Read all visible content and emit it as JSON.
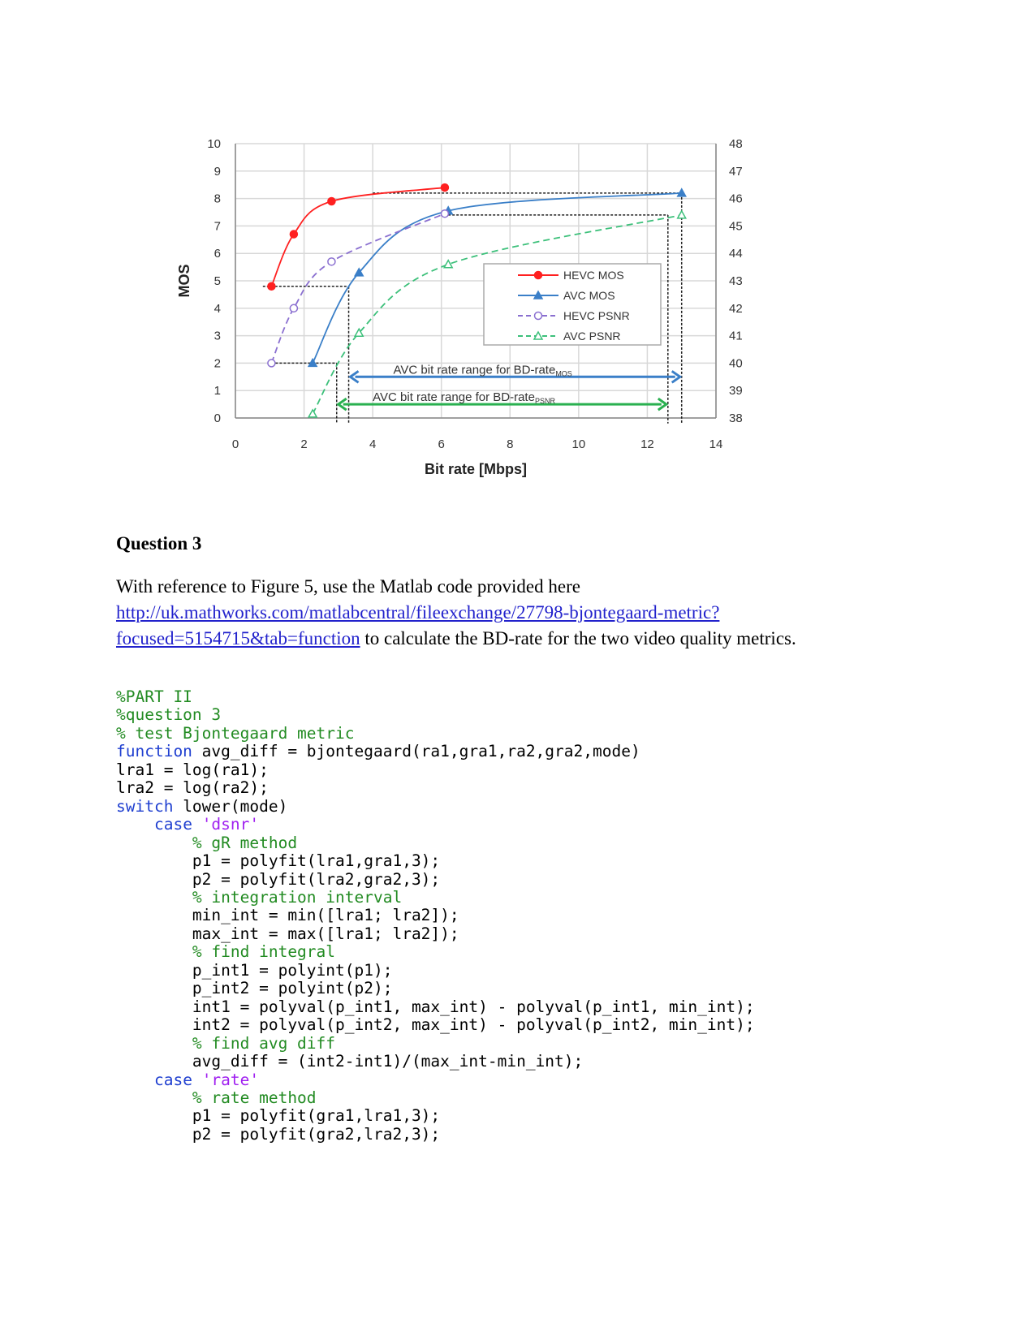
{
  "chart_data": {
    "type": "line",
    "xlabel": "Bit rate [Mbps]",
    "ylabel": "MOS",
    "xlim": [
      0,
      14
    ],
    "ylim": [
      0,
      10
    ],
    "y2lim": [
      38,
      48
    ],
    "xticks": [
      "0",
      "2",
      "4",
      "6",
      "8",
      "10",
      "12",
      "14"
    ],
    "yticks": [
      "0",
      "1",
      "2",
      "3",
      "4",
      "5",
      "6",
      "7",
      "8",
      "9",
      "10"
    ],
    "y2ticks": [
      "38",
      "39",
      "40",
      "41",
      "42",
      "43",
      "44",
      "45",
      "46",
      "47",
      "48"
    ],
    "grid": true,
    "legend_position": "center-right",
    "series": [
      {
        "name": "HEVC MOS",
        "color": "#ff2020",
        "style": "solid",
        "marker": "filled-circle",
        "x": [
          1.05,
          1.7,
          2.8,
          6.1
        ],
        "y": [
          4.8,
          6.7,
          7.9,
          8.4
        ]
      },
      {
        "name": "AVC MOS",
        "color": "#3a7fc8",
        "style": "solid",
        "marker": "filled-triangle",
        "x": [
          2.25,
          3.6,
          6.2,
          13.0
        ],
        "y": [
          2.0,
          5.3,
          7.55,
          8.2
        ]
      },
      {
        "name": "HEVC PSNR",
        "color": "#8a6fd0",
        "style": "dashed",
        "marker": "open-circle",
        "x": [
          1.05,
          1.7,
          2.8,
          6.1
        ],
        "y": [
          2.0,
          4.0,
          5.7,
          7.45
        ]
      },
      {
        "name": "AVC PSNR",
        "color": "#3cc07a",
        "style": "dashed",
        "marker": "open-triangle",
        "x": [
          2.25,
          3.6,
          6.2,
          13.0
        ],
        "y": [
          0.15,
          3.1,
          5.6,
          7.4
        ]
      }
    ],
    "reference_lines": [
      {
        "x": [
          0.8,
          3.3
        ],
        "y": [
          4.8,
          4.8
        ]
      },
      {
        "x": [
          3.3,
          3.3
        ],
        "y": [
          4.8,
          -0.2
        ]
      },
      {
        "x": [
          1.05,
          2.95
        ],
        "y": [
          2.0,
          2.0
        ]
      },
      {
        "x": [
          2.95,
          2.95
        ],
        "y": [
          2.0,
          -0.2
        ]
      },
      {
        "x": [
          4.0,
          13.0
        ],
        "y": [
          8.2,
          8.2
        ]
      },
      {
        "x": [
          13.0,
          13.0
        ],
        "y": [
          8.2,
          -0.2
        ]
      },
      {
        "x": [
          6.2,
          12.6
        ],
        "y": [
          7.4,
          7.4
        ]
      },
      {
        "x": [
          12.6,
          12.6
        ],
        "y": [
          7.4,
          -0.2
        ]
      }
    ],
    "annotations": [
      {
        "text": "AVC bit rate range for BD-rate",
        "sub": "MOS",
        "color": "#3a7fc8",
        "x_from": 3.3,
        "x_to": 13.0,
        "y": 1.5
      },
      {
        "text": "AVC bit rate range for BD-rate",
        "sub": "PSNR",
        "color": "#2ab050",
        "x_from": 2.95,
        "x_to": 12.6,
        "y": 0.5
      }
    ]
  },
  "heading": "Question 3",
  "paragraph": {
    "before": "With reference to Figure 5, use the Matlab code provided here",
    "link": "http://uk.mathworks.com/matlabcentral/fileexchange/27798-bjontegaard-metric?focused=5154715&tab=function",
    "link_line1": "http://uk.mathworks.com/matlabcentral/fileexchange/27798-bjontegaard-metric?",
    "link_line2": "focused=5154715&tab=function",
    "after": " to calculate the BD-rate for the two video quality metrics."
  },
  "code": [
    [
      [
        "cm",
        "%PART II"
      ]
    ],
    [
      [
        "cm",
        "%question 3"
      ]
    ],
    [
      [
        "cm",
        "% test Bjontegaard metric"
      ]
    ],
    [
      [
        "kw",
        "function"
      ],
      [
        "tx",
        " avg_diff = bjontegaard(ra1,gra1,ra2,gra2,mode)"
      ]
    ],
    [
      [
        "tx",
        "lra1 = log(ra1);"
      ]
    ],
    [
      [
        "tx",
        "lra2 = log(ra2);"
      ]
    ],
    [
      [
        "kw",
        "switch"
      ],
      [
        "tx",
        " lower(mode)"
      ]
    ],
    [
      [
        "tx",
        "    "
      ],
      [
        "kw",
        "case"
      ],
      [
        "tx",
        " "
      ],
      [
        "st",
        "'dsnr'"
      ]
    ],
    [
      [
        "tx",
        "        "
      ],
      [
        "cm",
        "% gR method"
      ]
    ],
    [
      [
        "tx",
        "        p1 = polyfit(lra1,gra1,3);"
      ]
    ],
    [
      [
        "tx",
        "        p2 = polyfit(lra2,gra2,3);"
      ]
    ],
    [
      [
        "tx",
        "        "
      ],
      [
        "cm",
        "% integration interval"
      ]
    ],
    [
      [
        "tx",
        "        min_int = min([lra1; lra2]);"
      ]
    ],
    [
      [
        "tx",
        "        max_int = max([lra1; lra2]);"
      ]
    ],
    [
      [
        "tx",
        "        "
      ],
      [
        "cm",
        "% find integral"
      ]
    ],
    [
      [
        "tx",
        "        p_int1 = polyint(p1);"
      ]
    ],
    [
      [
        "tx",
        "        p_int2 = polyint(p2);"
      ]
    ],
    [
      [
        "tx",
        "        int1 = polyval(p_int1, max_int) - polyval(p_int1, min_int);"
      ]
    ],
    [
      [
        "tx",
        "        int2 = polyval(p_int2, max_int) - polyval(p_int2, min_int);"
      ]
    ],
    [
      [
        "tx",
        "        "
      ],
      [
        "cm",
        "% find avg diff"
      ]
    ],
    [
      [
        "tx",
        "        avg_diff = (int2-int1)/(max_int-min_int);"
      ]
    ],
    [
      [
        "tx",
        "    "
      ],
      [
        "kw",
        "case"
      ],
      [
        "tx",
        " "
      ],
      [
        "st",
        "'rate'"
      ]
    ],
    [
      [
        "tx",
        "        "
      ],
      [
        "cm",
        "% rate method"
      ]
    ],
    [
      [
        "tx",
        "        p1 = polyfit(gra1,lra1,3);"
      ]
    ],
    [
      [
        "tx",
        "        p2 = polyfit(gra2,lra2,3);"
      ]
    ]
  ]
}
